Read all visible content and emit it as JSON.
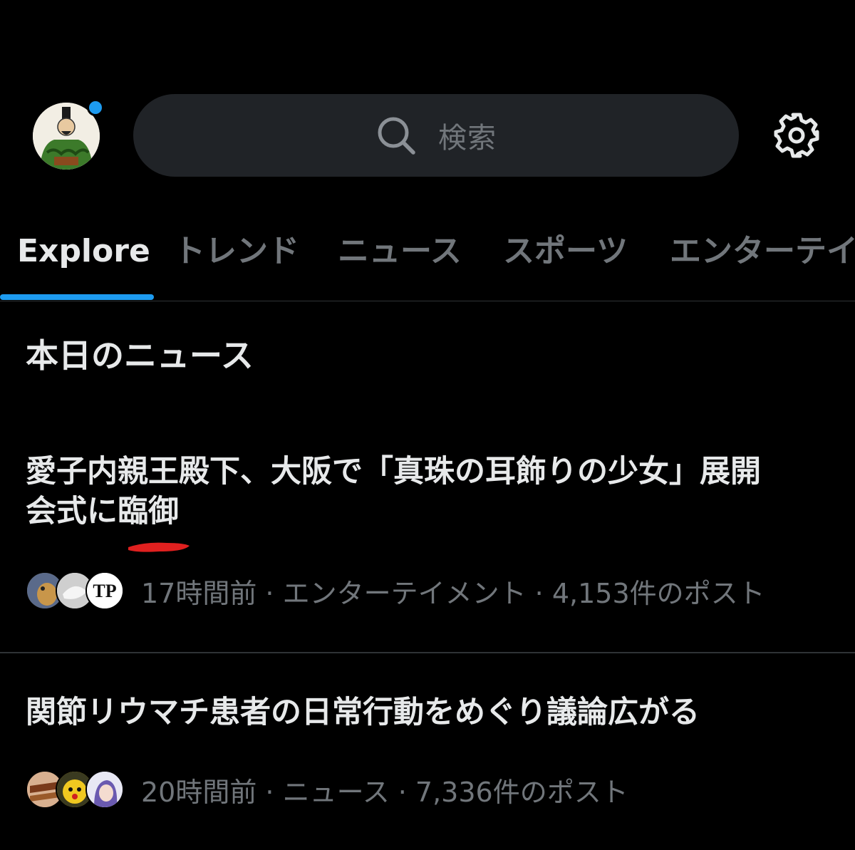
{
  "header": {
    "search_placeholder": "検索",
    "avatar_icon": "profile-avatar-icon",
    "settings_icon": "gear-icon",
    "accent_color": "#1d9bf0"
  },
  "tabs": [
    {
      "label": "Explore",
      "active": true
    },
    {
      "label": "トレンド",
      "active": false
    },
    {
      "label": "ニュース",
      "active": false
    },
    {
      "label": "スポーツ",
      "active": false
    },
    {
      "label": "エンターテイ",
      "active": false
    }
  ],
  "section_title": "本日のニュース",
  "news": [
    {
      "headline_line1": "愛子内親王殿下、大阪で「真珠の耳飾りの少女」展開",
      "headline_line2": "会式に臨御",
      "meta": "17時間前 · エンターテイメント · 4,153件のポスト",
      "annotation_color": "#e0201f"
    },
    {
      "headline": "関節リウマチ患者の日常行動をめぐり議論広がる",
      "meta": "20時間前 · ニュース · 7,336件のポスト"
    }
  ],
  "colors": {
    "background": "#000000",
    "text_primary": "#e7e9ea",
    "text_secondary": "#71767b",
    "search_bg": "#202327",
    "divider": "#2f3336"
  }
}
